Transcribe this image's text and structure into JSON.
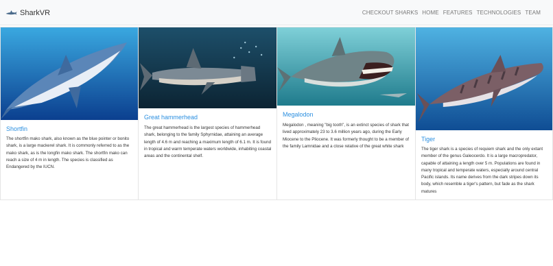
{
  "brand": {
    "name": "SharkVR",
    "logo_icon": "shark-logo-icon"
  },
  "nav": {
    "items": [
      "CHECKOUT SHARKS",
      "HOME",
      "FEATURES",
      "TECHNOLOGIES",
      "TEAM"
    ]
  },
  "colors": {
    "link": "#2b8fe0",
    "navbar_bg": "#f8f9fa",
    "nav_text": "#777777"
  },
  "cards": [
    {
      "title": "Shortfin",
      "image_icon": "shortfin-shark-image",
      "text": "The shortfin mako shark, also known as the blue pointer or bonito shark, is a large mackerel shark. It is commonly referred to as the mako shark, as is the longfin mako shark. The shortfin mako can reach a size of 4 m in length. The species is classified as Endangered by the IUCN."
    },
    {
      "title": "Great hammerhead",
      "image_icon": "hammerhead-shark-image",
      "text": "The great hammerhead is the largest species of hammerhead shark, belonging to the family Sphyrnidae, attaining an average length of 4.6 m and reaching a maximum length of 6.1 m. It is found in tropical and warm temperate waters worldwide, inhabiting coastal areas and the continental shelf."
    },
    {
      "title": "Megalodon",
      "image_icon": "megalodon-shark-image",
      "text": "Megalodon , meaning \"big tooth\", is an extinct species of shark that lived approximately 23 to 3.6 million years ago, during the Early Miocene to the Pliocene. It was formerly thought to be a member of the family Lamnidae and a close relative of the great white shark"
    },
    {
      "title": "Tiger",
      "image_icon": "tiger-shark-image",
      "text": "The tiger shark is a species of requiem shark and the only extant member of the genus Galeocerdo. It is a large macropredator, capable of attaining a length over 5 m. Populations are found in many tropical and temperate waters, especially around central Pacific islands. Its name derives from the dark stripes down its body, which resemble a tiger's pattern, but fade as the shark matures"
    }
  ]
}
